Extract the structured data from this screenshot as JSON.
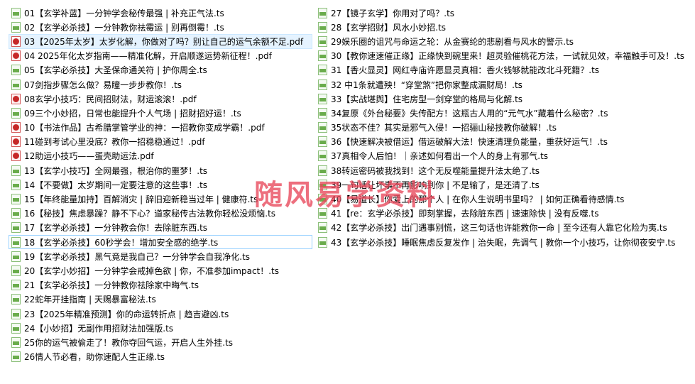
{
  "watermark": "随风易学资料",
  "files_left": [
    {
      "name": "01【玄学补蓝】一分钟学会秘传最强 | 补充正气法.ts",
      "type": "ts"
    },
    {
      "name": "02【玄学必杀技】一分钟教你祛霉运 | 别再倒霉！.ts",
      "type": "ts"
    },
    {
      "name": "03【2025年太岁】太岁化解，你做对了吗？别让自己的运气余额不足.pdf",
      "type": "pdf"
    },
    {
      "name": "04 2025年化太岁指南——精准化解，开启顺遂运势新征程！.pdf",
      "type": "pdf"
    },
    {
      "name": "05【玄学必杀技】大圣保命通关符 | 护你周全.ts",
      "type": "ts"
    },
    {
      "name": "07剑指步骤怎么做？易瞳一步步教你！.ts",
      "type": "ts"
    },
    {
      "name": "08玄学小技巧：民间招财法，财运滚滚！.pdf",
      "type": "pdf"
    },
    {
      "name": "09三个小妙招，日常也能提升个人气场 | 招财招好运！.ts",
      "type": "ts"
    },
    {
      "name": "10【书法作品】古希腊掌管学业的神：一招教你变成学霸！.pdf",
      "type": "pdf"
    },
    {
      "name": "11碰到考试心里没底？教你一招稳稳通过！.pdf",
      "type": "pdf"
    },
    {
      "name": "12助运小技巧——蛋壳助运法.pdf",
      "type": "pdf"
    },
    {
      "name": "13【玄学小技巧】全网最强，根治你的噩梦！.ts",
      "type": "ts"
    },
    {
      "name": "14【不要做】太岁期间一定要注意的这些事！.ts",
      "type": "ts"
    },
    {
      "name": "15【年终能量加持】百解消灾 | 辞旧迎新稳当过年 | 健康符.ts",
      "type": "ts"
    },
    {
      "name": "16【秘技】焦虑暴躁？静不下心？道家秘传古法教你轻松没烦恼.ts",
      "type": "ts"
    },
    {
      "name": "17【玄学必杀技】一分钟教会你！去除脏东西.ts",
      "type": "ts"
    },
    {
      "name": "18【玄学必杀技】60秒学会！增加安全感的绝学.ts",
      "type": "ts"
    },
    {
      "name": "19【玄学必杀技】黑气竟是我自己？一分钟学会自我净化.ts",
      "type": "ts"
    },
    {
      "name": "20【玄学小妙招】一分钟学会戒掉色欲 | 你，不准参加impact！.ts",
      "type": "ts"
    },
    {
      "name": "21【玄学必杀技】一分钟教你祛除家中晦气.ts",
      "type": "ts"
    },
    {
      "name": "22蛇年开挂指南 | 天赐暴富秘法.ts",
      "type": "ts"
    },
    {
      "name": "23【2025年精准预测】你的命运转折点 | 趋吉避凶.ts",
      "type": "ts"
    },
    {
      "name": "24【小妙招】无副作用招财法加强版.ts",
      "type": "ts"
    },
    {
      "name": "25你的运气被偷走了！教你夺回气运，开启人生外挂.ts",
      "type": "ts"
    },
    {
      "name": "26情人节必看，助你速配人生正缘.ts",
      "type": "ts"
    }
  ],
  "files_right": [
    {
      "name": "27【镜子玄学】你用对了吗？.ts",
      "type": "ts"
    },
    {
      "name": "28【玄学招财】风水小妙招.ts",
      "type": "ts"
    },
    {
      "name": "29娱乐圈的诅咒与命运之轮：从金赛纶的悲剧看与风水的警示.ts",
      "type": "ts"
    },
    {
      "name": "30【教你速速催正缘】正缘快到碗里来！超灵验催桃花方法，一试就见效，幸福触手可及！.ts",
      "type": "ts"
    },
    {
      "name": "31【香火显灵】网红寺庙许愿显灵真相：香火钱够就能改北斗死籍？.ts",
      "type": "ts"
    },
    {
      "name": "32 中1条就遭殃！“穿堂煞”把你家整成漏财局！.ts",
      "type": "ts"
    },
    {
      "name": "33【实战堪舆】住宅房型一剑穿堂的格局与化解.ts",
      "type": "ts"
    },
    {
      "name": "34复原《外台秘要》失传配方！这瓶古人用的“元气水”藏着什么秘密？.ts",
      "type": "ts"
    },
    {
      "name": "35状态不佳？其实是邪气入侵！一招骊山秘技教你破解！.ts",
      "type": "ts"
    },
    {
      "name": "36【快速解决被借运】借运破解大法！快速清理负能量，重获好运气！.ts",
      "type": "ts"
    },
    {
      "name": "37真相令人后怕！｜亲述如何看出一个人的身上有邪气.ts",
      "type": "ts"
    },
    {
      "name": "38转运密码被我找到！这个无反噬能量提升法太绝了.ts",
      "type": "ts"
    },
    {
      "name": "39一句话让坏事不再影响到你 | 不是输了，是还清了.ts",
      "type": "ts"
    },
    {
      "name": "40【易道长】你爱上的那个人 | 在你人生说明书里吗？ | 如何正确看待感情.ts",
      "type": "ts"
    },
    {
      "name": "41【re：玄学必杀技】即刻掌握，去除脏东西 | 速速除快 | 没有反噬.ts",
      "type": "ts"
    },
    {
      "name": "42【玄学必杀技】出门遇事别慌，这三句话也许能救你一命 | 至今还有人靠它化险为夷.ts",
      "type": "ts"
    },
    {
      "name": "43【玄学必杀技】睡眠焦虑反复发作 | 治失眠，先调气 | 教你一个小技巧，让你彻夜安宁.ts",
      "type": "ts"
    }
  ]
}
